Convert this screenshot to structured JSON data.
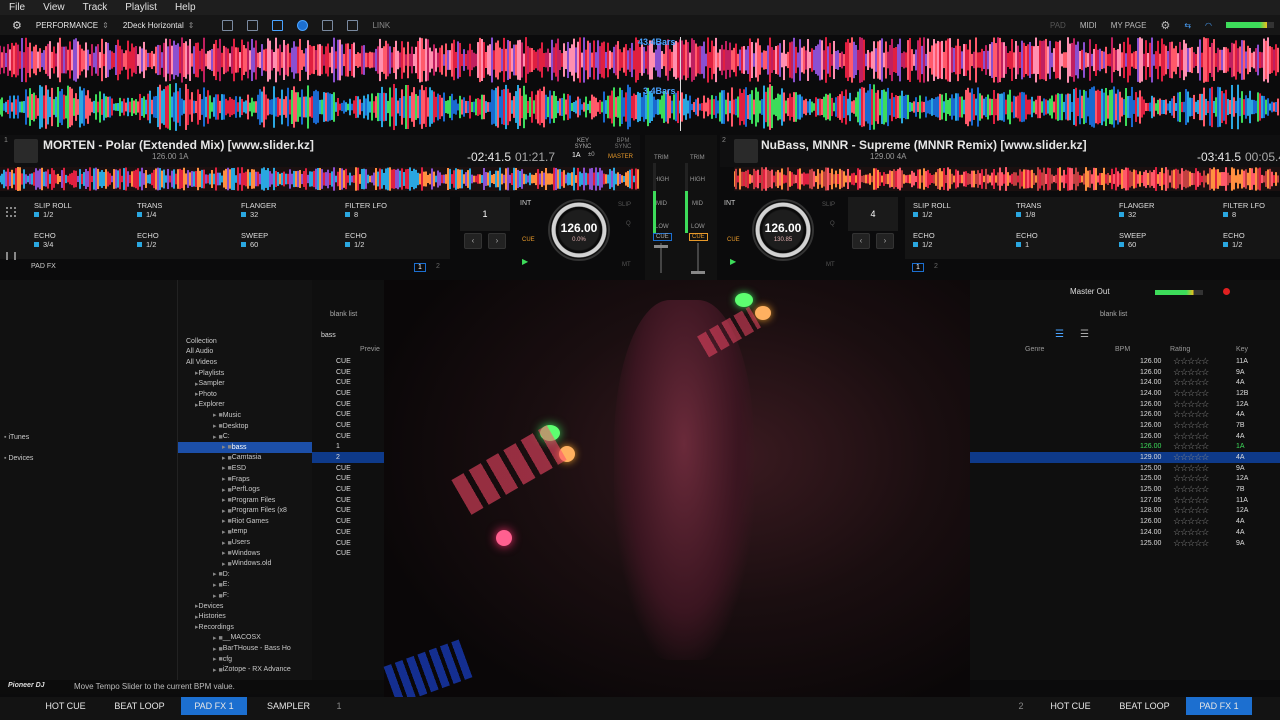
{
  "menu": [
    "File",
    "View",
    "Track",
    "Playlist",
    "Help"
  ],
  "toolbar": {
    "mode": "PERFORMANCE",
    "layout": "2Deck Horizontal",
    "link": "LINK",
    "right": [
      "PAD",
      "MIDI",
      "MY PAGE"
    ]
  },
  "waveform": {
    "bars_top": "43.4Bars",
    "bars_bottom": "3.4Bars"
  },
  "deck1": {
    "num": "1",
    "title": "MORTEN - Polar (Extended Mix) [www.slider.kz]",
    "sub": "126.00 1A",
    "remain": "-02:41.5",
    "elapsed": "01:21.7",
    "key_sync": "KEY SYNC",
    "bpm_sync": "BPM SYNC",
    "master": "MASTER",
    "key_val": "1A",
    "key_off": "±0",
    "bpm": "126.00",
    "pitch": "0.0%",
    "range": "±10",
    "beat": "1",
    "int": "INT",
    "slip": "SLIP",
    "q": "Q",
    "mt": "MT",
    "cue": "CUE",
    "pads": [
      {
        "name": "SLIP ROLL",
        "val": "1/2"
      },
      {
        "name": "TRANS",
        "val": "1/4"
      },
      {
        "name": "FLANGER",
        "val": "32"
      },
      {
        "name": "FILTER LFO",
        "val": "8"
      },
      {
        "name": "ECHO",
        "val": "3/4"
      },
      {
        "name": "ECHO",
        "val": "1/2"
      },
      {
        "name": "SWEEP",
        "val": "60"
      },
      {
        "name": "ECHO",
        "val": "1/2"
      }
    ],
    "padfx": "PAD FX",
    "page1": "1",
    "page2": "2"
  },
  "deck2": {
    "num": "2",
    "title": "NuBass, MNNR - Supreme (MNNR Remix) [www.slider.kz]",
    "sub": "129.00 4A",
    "remain": "-03:41.5",
    "elapsed": "00:05.4",
    "bpm": "126.00",
    "pitch": "130.85",
    "range": "±10",
    "beat": "4",
    "int": "INT",
    "slip": "SLIP",
    "q": "Q",
    "mt": "MT",
    "cue": "CUE",
    "pads": [
      {
        "name": "SLIP ROLL",
        "val": "1/2"
      },
      {
        "name": "TRANS",
        "val": "1/8"
      },
      {
        "name": "FLANGER",
        "val": "32"
      },
      {
        "name": "FILTER LFO",
        "val": "8"
      },
      {
        "name": "ECHO",
        "val": "1/2"
      },
      {
        "name": "ECHO",
        "val": "1"
      },
      {
        "name": "SWEEP",
        "val": "60"
      },
      {
        "name": "ECHO",
        "val": "1/2"
      }
    ],
    "page1": "1",
    "page2": "2"
  },
  "mixer": {
    "trim": "TRIM",
    "high": "HIGH",
    "mid": "MID",
    "low": "LOW",
    "cue": "CUE"
  },
  "sidebar": {
    "items": [
      "iTunes",
      "Devices"
    ]
  },
  "tree": [
    {
      "label": "Collection",
      "indent": 0
    },
    {
      "label": "All Audio",
      "indent": 0
    },
    {
      "label": "All Videos",
      "indent": 0
    },
    {
      "label": "Playlists",
      "indent": 1
    },
    {
      "label": "Sampler",
      "indent": 1
    },
    {
      "label": "Photo",
      "indent": 1
    },
    {
      "label": "Explorer",
      "indent": 1
    },
    {
      "label": "Music",
      "indent": 3
    },
    {
      "label": "Desktop",
      "indent": 3
    },
    {
      "label": "C:",
      "indent": 3
    },
    {
      "label": "bass",
      "indent": 4,
      "selected": true
    },
    {
      "label": "Camtasia",
      "indent": 4
    },
    {
      "label": "ESD",
      "indent": 4
    },
    {
      "label": "Fraps",
      "indent": 4
    },
    {
      "label": "PerfLogs",
      "indent": 4
    },
    {
      "label": "Program Files",
      "indent": 4
    },
    {
      "label": "Program Files (x8",
      "indent": 4
    },
    {
      "label": "Riot Games",
      "indent": 4
    },
    {
      "label": "temp",
      "indent": 4
    },
    {
      "label": "Users",
      "indent": 4
    },
    {
      "label": "Windows",
      "indent": 4
    },
    {
      "label": "Windows.old",
      "indent": 4
    },
    {
      "label": "D:",
      "indent": 3
    },
    {
      "label": "E:",
      "indent": 3
    },
    {
      "label": "F:",
      "indent": 3
    },
    {
      "label": "Devices",
      "indent": 1
    },
    {
      "label": "Histories",
      "indent": 1
    },
    {
      "label": "Recordings",
      "indent": 1
    },
    {
      "label": "__MACOSX",
      "indent": 3
    },
    {
      "label": "BarTHouse - Bass Ho",
      "indent": 3
    },
    {
      "label": "cfg",
      "indent": 3
    },
    {
      "label": "iZotope - RX Advance",
      "indent": 3
    }
  ],
  "list_header": {
    "blank_list": "blank list",
    "folder": "bass",
    "preview": "Previe"
  },
  "list_rows": [
    "CUE",
    "CUE",
    "CUE",
    "CUE",
    "CUE",
    "CUE",
    "CUE",
    "CUE",
    "1",
    "2",
    "CUE",
    "CUE",
    "CUE",
    "CUE",
    "CUE",
    "CUE",
    "CUE",
    "CUE",
    "CUE"
  ],
  "right_panel": {
    "master_out": "Master Out",
    "blank_list": "blank list",
    "columns": [
      "Genre",
      "BPM",
      "Rating",
      "Key"
    ],
    "rows": [
      {
        "bpm": "126.00",
        "key": "11A"
      },
      {
        "bpm": "126.00",
        "key": "9A"
      },
      {
        "bpm": "124.00",
        "key": "4A"
      },
      {
        "bpm": "124.00",
        "key": "12B"
      },
      {
        "bpm": "126.00",
        "key": "12A"
      },
      {
        "bpm": "126.00",
        "key": "4A"
      },
      {
        "bpm": "126.00",
        "key": "7B"
      },
      {
        "bpm": "126.00",
        "key": "4A"
      },
      {
        "bpm": "126.00",
        "key": "1A",
        "loaded": true
      },
      {
        "bpm": "129.00",
        "key": "4A",
        "selected": true
      },
      {
        "bpm": "125.00",
        "key": "9A"
      },
      {
        "bpm": "125.00",
        "key": "12A"
      },
      {
        "bpm": "125.00",
        "key": "7B"
      },
      {
        "bpm": "127.05",
        "key": "11A"
      },
      {
        "bpm": "128.00",
        "key": "12A"
      },
      {
        "bpm": "126.00",
        "key": "4A"
      },
      {
        "bpm": "124.00",
        "key": "4A"
      },
      {
        "bpm": "125.00",
        "key": "9A"
      }
    ]
  },
  "status": {
    "logo": "Pioneer DJ",
    "message": "Move Tempo Slider to the current BPM value."
  },
  "bottom": {
    "left": [
      "HOT CUE",
      "BEAT LOOP",
      "PAD FX 1",
      "SAMPLER"
    ],
    "left_num": "1",
    "right_num": "2",
    "right": [
      "HOT CUE",
      "BEAT LOOP",
      "PAD FX 1"
    ]
  },
  "colors": {
    "accent": "#1c6fd0",
    "wave_red": "#e02040",
    "wave_blue": "#2aa7e0",
    "selected_row": "#0e3a8a",
    "green": "#3ddc5a"
  }
}
